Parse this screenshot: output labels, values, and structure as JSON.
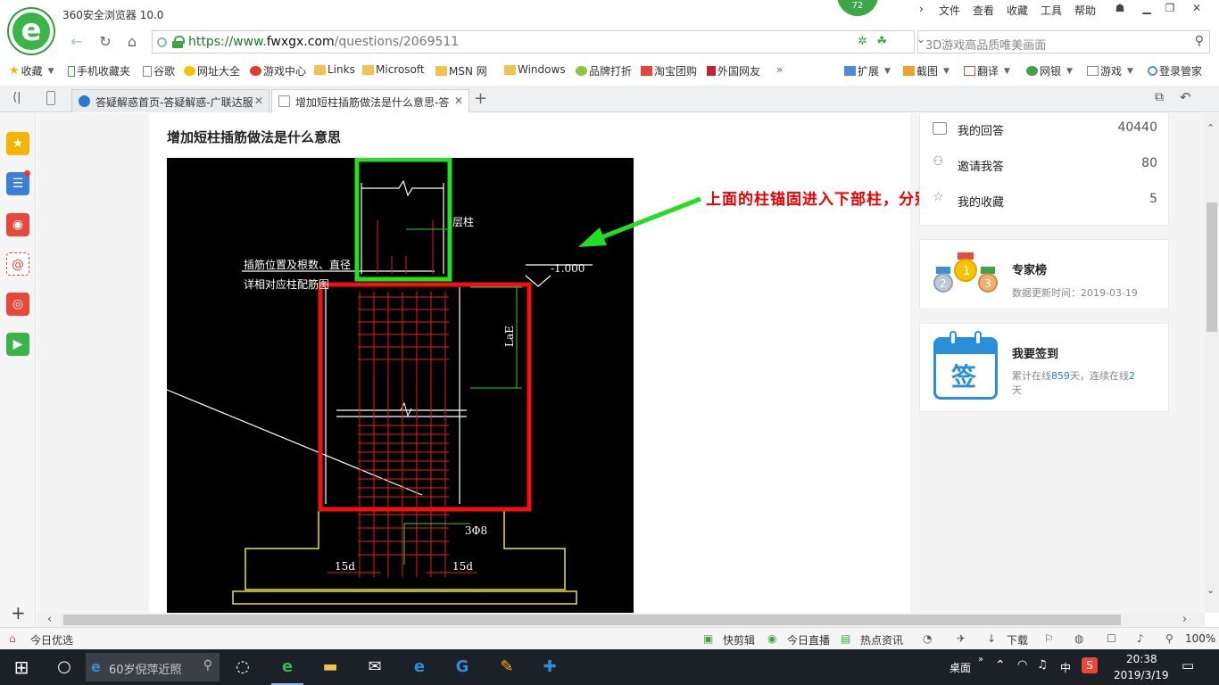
{
  "titlebar": {
    "app_title": "360安全浏览器 10.0",
    "badge": "72",
    "menus": [
      "文件",
      "查看",
      "收藏",
      "工具",
      "帮助"
    ]
  },
  "address": {
    "url_scheme": "https://www.",
    "url_domain": "fwxgx.com",
    "url_path": "/questions/2069511",
    "search_placeholder": "3D游戏高品质唯美画面"
  },
  "bookmarks": {
    "left": [
      "收藏",
      "手机收藏夹",
      "谷歌",
      "网址大全",
      "游戏中心",
      "Links",
      "Microsoft",
      "MSN 网",
      "Windows",
      "品牌打折",
      "淘宝团购",
      "外国网友"
    ],
    "more": "»",
    "right": [
      "扩展",
      "截图",
      "翻译",
      "网银",
      "游戏",
      "登录管家"
    ]
  },
  "tabs": [
    {
      "label": "答疑解惑首页-答疑解惑-广联达服"
    },
    {
      "label": "增加短柱插筋做法是什么意思-答"
    }
  ],
  "page": {
    "question_title": "增加短柱插筋做法是什么意思",
    "annotation": "上面的柱锚固进入下部柱，分别定义框架柱",
    "cad_labels": {
      "top_label": "层柱",
      "note_line1": "插筋位置及根数、直径",
      "note_line2": "详相对应柱配筋图",
      "elevation": "-1.000",
      "lae": "LaE",
      "bar": "3Φ8",
      "hook_left": "15d",
      "hook_right": "15d"
    }
  },
  "sidebar_right": {
    "stats": [
      {
        "label": "我的回答",
        "value": "40440"
      },
      {
        "label": "邀请我答",
        "value": "80"
      },
      {
        "label": "我的收藏",
        "value": "5"
      }
    ],
    "experts": {
      "title": "专家榜",
      "subtitle": "数据更新时间：2019-03-19",
      "medals": [
        "1",
        "2",
        "3"
      ]
    },
    "signin": {
      "title": "我要签到",
      "icon_char": "签",
      "text_prefix": "累计在线",
      "days_total": "859",
      "text_middle": "天，连续在线",
      "days_streak": "2",
      "text_suffix": "天"
    }
  },
  "statusbar": {
    "left": "今日优选",
    "items": [
      "快剪辑",
      "今日直播",
      "热点资讯",
      "下载"
    ],
    "zoom": "100%"
  },
  "taskbar": {
    "search_text": "60岁倪萍近照",
    "desktop_label": "桌面",
    "ime": "中",
    "time": "20:38",
    "date": "2019/3/19"
  },
  "colors": {
    "brand_green": "#3bb54a",
    "annotation_red": "#ee0000",
    "link_blue": "#2a7ad2"
  }
}
